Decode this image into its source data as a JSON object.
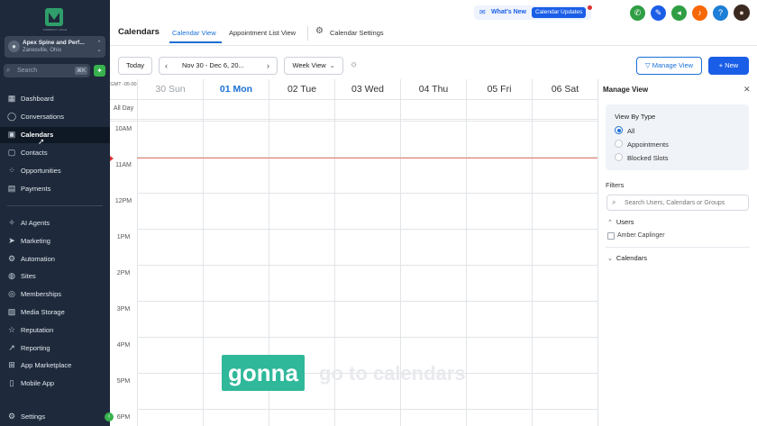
{
  "sidebar": {
    "logo_text": "COMPANY LOGO",
    "account_name": "Apex Spine and Perf...",
    "account_location": "Zanesville, Ohio",
    "search_placeholder": "Search",
    "search_shortcut": "⌘K",
    "nav_primary": [
      {
        "label": "Dashboard",
        "icon": "grid-icon"
      },
      {
        "label": "Conversations",
        "icon": "chat-icon"
      },
      {
        "label": "Calendars",
        "icon": "calendar-icon",
        "active": true
      },
      {
        "label": "Contacts",
        "icon": "contacts-icon"
      },
      {
        "label": "Opportunities",
        "icon": "opportunities-icon"
      },
      {
        "label": "Payments",
        "icon": "payments-icon"
      }
    ],
    "nav_secondary": [
      {
        "label": "AI Agents",
        "icon": "sparkle-icon"
      },
      {
        "label": "Marketing",
        "icon": "send-icon"
      },
      {
        "label": "Automation",
        "icon": "automation-icon"
      },
      {
        "label": "Sites",
        "icon": "globe-icon"
      },
      {
        "label": "Memberships",
        "icon": "membership-icon"
      },
      {
        "label": "Media Storage",
        "icon": "media-icon"
      },
      {
        "label": "Reputation",
        "icon": "star-icon"
      },
      {
        "label": "Reporting",
        "icon": "chart-icon"
      },
      {
        "label": "App Marketplace",
        "icon": "apps-icon"
      },
      {
        "label": "Mobile App",
        "icon": "mobile-icon"
      }
    ],
    "settings_label": "Settings"
  },
  "topbar": {
    "whats_new": "What's New",
    "calendar_updates": "Calendar Updates"
  },
  "header": {
    "title": "Calendars",
    "tabs": [
      "Calendar View",
      "Appointment List View"
    ],
    "settings_label": "Calendar Settings"
  },
  "toolbar": {
    "today": "Today",
    "date_range": "Nov 30 - Dec 6, 20...",
    "view": "Week View",
    "manage_view": "Manage View",
    "new": "New"
  },
  "calendar": {
    "timezone": "GMT -05:00",
    "days": [
      "30 Sun",
      "01 Mon",
      "02 Tue",
      "03 Wed",
      "04 Thu",
      "05 Fri",
      "06 Sat"
    ],
    "all_day": "All Day",
    "hours": [
      "10AM",
      "11AM",
      "12PM",
      "1PM",
      "2PM",
      "3PM",
      "4PM",
      "5PM",
      "6PM"
    ]
  },
  "manage_panel": {
    "title": "Manage View",
    "view_by_type": "View By Type",
    "options": [
      "All",
      "Appointments",
      "Blocked Slots"
    ],
    "selected": "All",
    "filters": "Filters",
    "filter_placeholder": "Search Users, Calendars or Groups",
    "users_label": "Users",
    "user_item": "Amber Caplinger",
    "calendars_label": "Calendars"
  },
  "caption": {
    "word": "gonna",
    "faded": "go to calendars"
  },
  "colors": {
    "sidebar_bg": "#1e2a3b",
    "accent": "#1a5ee8",
    "caption_bg": "#2fb89a",
    "now_line": "#e8806e"
  }
}
